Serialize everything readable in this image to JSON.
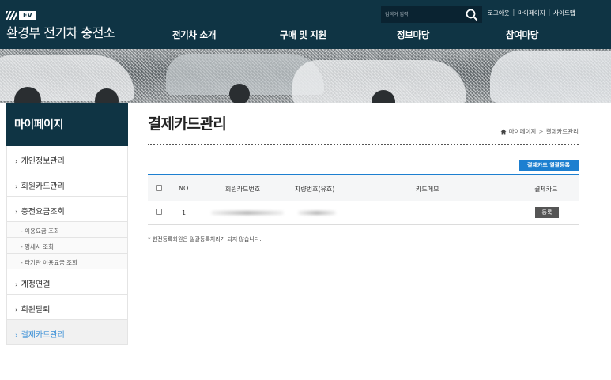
{
  "header": {
    "logo_badge": "EV",
    "site_title": "환경부 전기차 충전소",
    "search": {
      "placeholder": "검색어 입력",
      "icon": "search-icon"
    },
    "util_links": [
      "로그아웃",
      "마이페이지",
      "사이트맵"
    ],
    "gnb": [
      "전기차 소개",
      "구매 및 지원",
      "정보마당",
      "참여마당"
    ]
  },
  "sidebar": {
    "title": "마이페이지",
    "items": [
      {
        "label": "개인정보관리",
        "type": "item"
      },
      {
        "label": "회원카드관리",
        "type": "item"
      },
      {
        "label": "충전요금조회",
        "type": "item"
      },
      {
        "label": "- 이용요금 조회",
        "type": "sub"
      },
      {
        "label": "- 명세서 조회",
        "type": "sub"
      },
      {
        "label": "- 타기관 이용요금 조회",
        "type": "sub"
      },
      {
        "label": "계정연결",
        "type": "item"
      },
      {
        "label": "회원탈퇴",
        "type": "item"
      },
      {
        "label": "결제카드관리",
        "type": "item",
        "active": true
      }
    ]
  },
  "main": {
    "title": "결제카드관리",
    "breadcrumb": [
      "마이페이지",
      "결제카드관리"
    ],
    "bulk_button": "결제카드 일괄등록",
    "table": {
      "columns": [
        "NO",
        "회원카드번호",
        "차량번호(유효)",
        "카드메모",
        "결제카드"
      ],
      "rows": [
        {
          "no": "1",
          "card_no": "",
          "car_no": "",
          "memo": "",
          "action": "등록"
        }
      ]
    },
    "note": "* 한전등록회원은 일괄등록처리가 되지 않습니다."
  },
  "colors": {
    "header_bg": "#0f3444",
    "accent": "#1d7fd0",
    "active_link": "#3a8fd6"
  }
}
